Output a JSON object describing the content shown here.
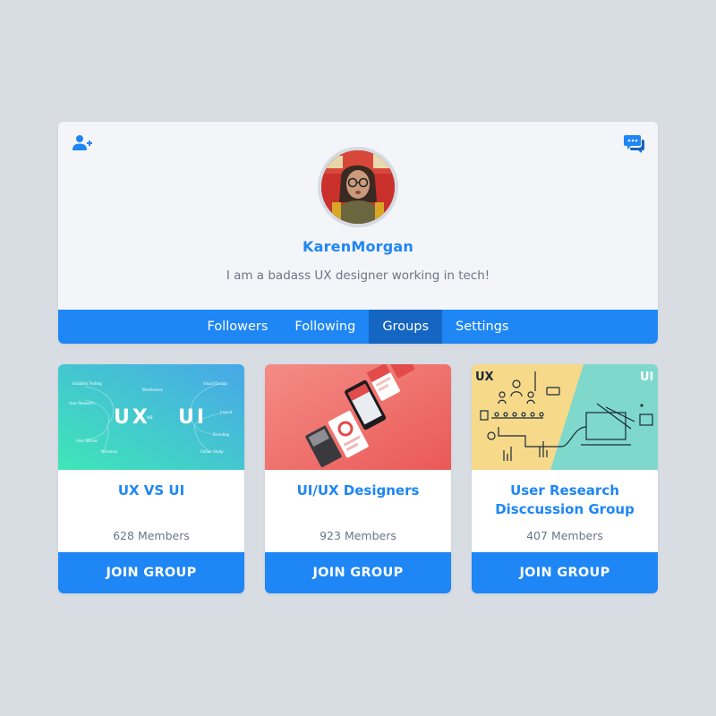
{
  "profile": {
    "username": "KarenMorgan",
    "bio": "I am a badass UX designer working in tech!",
    "add_friend_icon": "add-user-icon",
    "messages_icon": "chat-bubbles-icon"
  },
  "tabs": [
    {
      "label": "Followers",
      "active": false
    },
    {
      "label": "Following",
      "active": false
    },
    {
      "label": "Groups",
      "active": true
    },
    {
      "label": "Settings",
      "active": false
    }
  ],
  "groups": [
    {
      "title": "UX VS UI",
      "members": "628 Members",
      "join_label": "JOIN GROUP",
      "image_text": {
        "left": "UX",
        "vs": "vs",
        "right": "UI",
        "left_terms": [
          "Usability Testing",
          "User Research",
          "User Stories",
          "Personas"
        ],
        "center_term": "Wireframes",
        "right_terms": [
          "Visual Design",
          "Layout",
          "Branding",
          "Colour Study"
        ]
      }
    },
    {
      "title": "UI/UX Designers",
      "members": "923 Members",
      "join_label": "JOIN GROUP"
    },
    {
      "title": "User Research Disccussion Group",
      "members": "407 Members",
      "join_label": "JOIN GROUP",
      "image_text": {
        "left": "UX",
        "right": "UI"
      }
    }
  ],
  "colors": {
    "primary": "#1e86f5",
    "tab_active": "#1466c2",
    "background": "#d8dde3",
    "card": "#f3f5f8",
    "muted_text": "#6b7686"
  }
}
